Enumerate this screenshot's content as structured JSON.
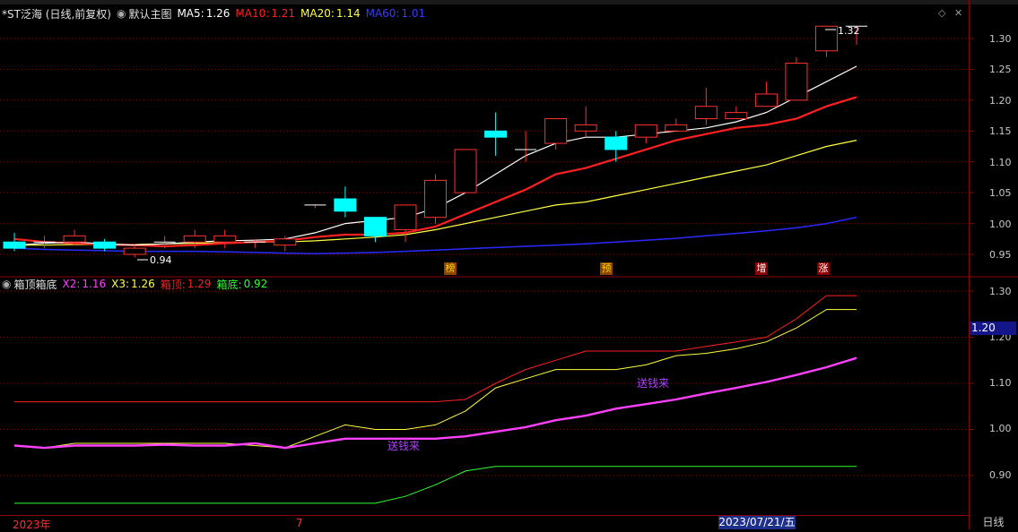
{
  "main_header": {
    "title": "*ST泛海 (日线,前复权)",
    "template_label": "默认主图",
    "indicators": [
      {
        "label": "MA5:",
        "value": "1.26",
        "color": "#ffffff"
      },
      {
        "label": "MA10:",
        "value": "1.21",
        "color": "#ff2020"
      },
      {
        "label": "MA20:",
        "value": "1.14",
        "color": "#ffff40"
      },
      {
        "label": "MA60:",
        "value": "1.01",
        "color": "#2a2aff"
      }
    ]
  },
  "sub_header": {
    "title": "箱顶箱底",
    "indicators": [
      {
        "label": "X2:",
        "value": "1.16",
        "color": "#ff40ff"
      },
      {
        "label": "X3:",
        "value": "1.26",
        "color": "#ffff40"
      },
      {
        "label": "箱顶:",
        "value": "1.29",
        "color": "#ff2020"
      },
      {
        "label": "箱底:",
        "value": "0.92",
        "color": "#30ff30"
      }
    ]
  },
  "price_axis": [
    "1.30",
    "1.25",
    "1.20",
    "1.15",
    "1.10",
    "1.05",
    "1.00",
    "0.95"
  ],
  "sub_axis": [
    "1.30",
    "1.20",
    "1.10",
    "1.00",
    "0.90"
  ],
  "current_value": "1.20",
  "date_labels": {
    "start": "2023年",
    "month": "7",
    "selected": "2023/07/21/五"
  },
  "period_button": "日线",
  "high_marker": "1.32",
  "low_marker": "0.94",
  "event_markers": [
    "榜",
    "预",
    "增",
    "涨"
  ],
  "sub_annotations": [
    "送钱来",
    "送钱来"
  ],
  "colors": {
    "up": "#ff3030",
    "down": "#00ffff",
    "ma5": "#ffffff",
    "ma10": "#ff2020",
    "ma20": "#ffff40",
    "ma60": "#2a2aff",
    "x2": "#ff40ff",
    "boxtop": "#ff2020",
    "boxbot": "#30ff30",
    "marker_bg": "#8b4500"
  },
  "chart_data": {
    "type": "candlestick",
    "candles": [
      {
        "o": 0.97,
        "h": 0.985,
        "l": 0.955,
        "c": 0.96
      },
      {
        "o": 0.97,
        "h": 0.98,
        "l": 0.96,
        "c": 0.97
      },
      {
        "o": 0.97,
        "h": 0.99,
        "l": 0.965,
        "c": 0.98
      },
      {
        "o": 0.97,
        "h": 0.975,
        "l": 0.955,
        "c": 0.96
      },
      {
        "o": 0.95,
        "h": 0.965,
        "l": 0.945,
        "c": 0.96
      },
      {
        "o": 0.97,
        "h": 0.98,
        "l": 0.96,
        "c": 0.97
      },
      {
        "o": 0.97,
        "h": 0.99,
        "l": 0.96,
        "c": 0.98
      },
      {
        "o": 0.97,
        "h": 0.99,
        "l": 0.96,
        "c": 0.98
      },
      {
        "o": 0.97,
        "h": 0.975,
        "l": 0.96,
        "c": 0.97
      },
      {
        "o": 0.965,
        "h": 0.98,
        "l": 0.955,
        "c": 0.975
      },
      {
        "o": 1.03,
        "h": 1.03,
        "l": 1.025,
        "c": 1.03
      },
      {
        "o": 1.04,
        "h": 1.06,
        "l": 1.01,
        "c": 1.02
      },
      {
        "o": 1.01,
        "h": 1.01,
        "l": 0.97,
        "c": 0.98
      },
      {
        "o": 0.99,
        "h": 1.03,
        "l": 0.97,
        "c": 1.03
      },
      {
        "o": 1.01,
        "h": 1.08,
        "l": 1.0,
        "c": 1.07
      },
      {
        "o": 1.05,
        "h": 1.12,
        "l": 1.05,
        "c": 1.12
      },
      {
        "o": 1.15,
        "h": 1.18,
        "l": 1.11,
        "c": 1.14
      },
      {
        "o": 1.12,
        "h": 1.15,
        "l": 1.1,
        "c": 1.12
      },
      {
        "o": 1.13,
        "h": 1.17,
        "l": 1.12,
        "c": 1.17
      },
      {
        "o": 1.15,
        "h": 1.19,
        "l": 1.14,
        "c": 1.16
      },
      {
        "o": 1.14,
        "h": 1.15,
        "l": 1.1,
        "c": 1.12
      },
      {
        "o": 1.14,
        "h": 1.16,
        "l": 1.13,
        "c": 1.16
      },
      {
        "o": 1.15,
        "h": 1.17,
        "l": 1.15,
        "c": 1.16
      },
      {
        "o": 1.17,
        "h": 1.22,
        "l": 1.16,
        "c": 1.19
      },
      {
        "o": 1.17,
        "h": 1.19,
        "l": 1.17,
        "c": 1.18
      },
      {
        "o": 1.19,
        "h": 1.23,
        "l": 1.19,
        "c": 1.21
      },
      {
        "o": 1.2,
        "h": 1.27,
        "l": 1.2,
        "c": 1.26
      },
      {
        "o": 1.28,
        "h": 1.32,
        "l": 1.27,
        "c": 1.32
      },
      {
        "o": 1.32,
        "h": 1.32,
        "l": 1.29,
        "c": 1.32
      }
    ],
    "ma5": [
      0.965,
      0.968,
      0.97,
      0.967,
      0.965,
      0.967,
      0.97,
      0.972,
      0.973,
      0.975,
      0.985,
      1.0,
      1.005,
      1.01,
      1.025,
      1.05,
      1.08,
      1.11,
      1.13,
      1.14,
      1.14,
      1.145,
      1.15,
      1.155,
      1.165,
      1.18,
      1.205,
      1.23,
      1.255
    ],
    "ma10": [
      0.975,
      0.97,
      0.968,
      0.966,
      0.965,
      0.963,
      0.965,
      0.968,
      0.97,
      0.972,
      0.978,
      0.982,
      0.982,
      0.985,
      0.995,
      1.015,
      1.035,
      1.055,
      1.08,
      1.09,
      1.105,
      1.12,
      1.135,
      1.145,
      1.155,
      1.16,
      1.17,
      1.19,
      1.205
    ],
    "ma20": [
      0.965,
      0.965,
      0.966,
      0.966,
      0.966,
      0.967,
      0.968,
      0.969,
      0.97,
      0.97,
      0.972,
      0.975,
      0.978,
      0.982,
      0.99,
      1.0,
      1.01,
      1.02,
      1.03,
      1.035,
      1.045,
      1.055,
      1.065,
      1.075,
      1.085,
      1.095,
      1.11,
      1.125,
      1.135
    ],
    "ma60": [
      0.96,
      0.958,
      0.957,
      0.956,
      0.955,
      0.955,
      0.955,
      0.954,
      0.953,
      0.952,
      0.951,
      0.952,
      0.953,
      0.955,
      0.957,
      0.959,
      0.961,
      0.963,
      0.965,
      0.967,
      0.97,
      0.973,
      0.976,
      0.98,
      0.984,
      0.988,
      0.993,
      1.0,
      1.01
    ],
    "x2": [
      0.965,
      0.96,
      0.965,
      0.965,
      0.965,
      0.967,
      0.965,
      0.965,
      0.97,
      0.96,
      0.97,
      0.98,
      0.98,
      0.98,
      0.98,
      0.985,
      0.995,
      1.005,
      1.02,
      1.03,
      1.045,
      1.055,
      1.065,
      1.078,
      1.09,
      1.103,
      1.118,
      1.135,
      1.155
    ],
    "x3": [
      0.965,
      0.96,
      0.97,
      0.97,
      0.97,
      0.97,
      0.97,
      0.97,
      0.965,
      0.96,
      0.985,
      1.01,
      1.0,
      1.0,
      1.01,
      1.04,
      1.09,
      1.11,
      1.13,
      1.13,
      1.13,
      1.14,
      1.16,
      1.165,
      1.175,
      1.19,
      1.22,
      1.26,
      1.26
    ],
    "box_top": [
      1.06,
      1.06,
      1.06,
      1.06,
      1.06,
      1.06,
      1.06,
      1.06,
      1.06,
      1.06,
      1.06,
      1.06,
      1.06,
      1.06,
      1.06,
      1.065,
      1.1,
      1.13,
      1.15,
      1.17,
      1.17,
      1.17,
      1.17,
      1.18,
      1.19,
      1.2,
      1.24,
      1.29,
      1.29
    ],
    "box_bot": [
      0.84,
      0.84,
      0.84,
      0.84,
      0.84,
      0.84,
      0.84,
      0.84,
      0.84,
      0.84,
      0.84,
      0.84,
      0.84,
      0.855,
      0.88,
      0.91,
      0.92,
      0.92,
      0.92,
      0.92,
      0.92,
      0.92,
      0.92,
      0.92,
      0.92,
      0.92,
      0.92,
      0.92,
      0.92
    ]
  }
}
